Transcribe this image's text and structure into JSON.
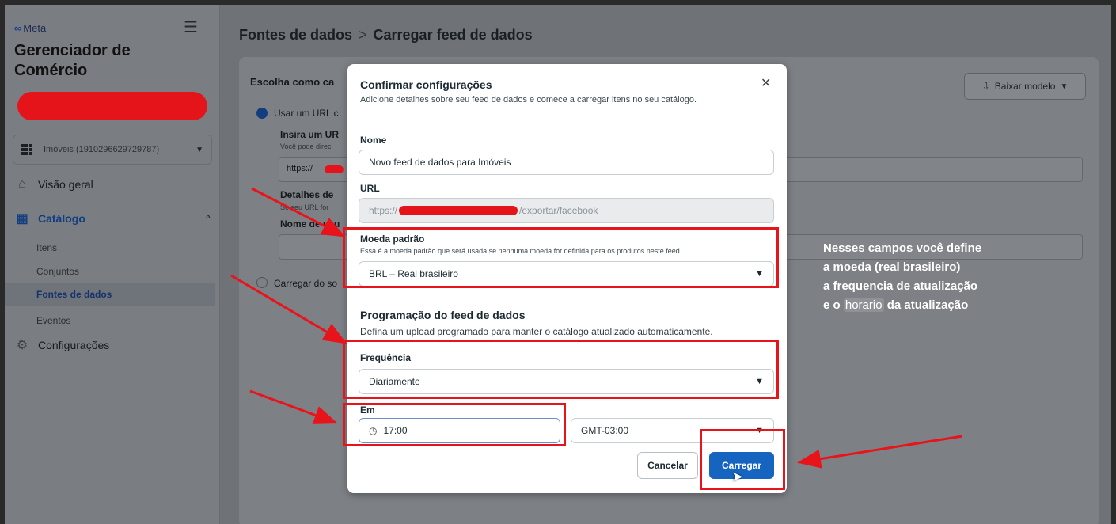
{
  "sidebar": {
    "logo": "Meta",
    "app_title": "Gerenciador de Comércio",
    "account": "Imóveis (1910296629729787)",
    "nav": {
      "overview": "Visão geral",
      "catalog": "Catálogo",
      "items": "Itens",
      "sets": "Conjuntos",
      "data_sources": "Fontes de dados",
      "events": "Eventos",
      "settings": "Configurações"
    }
  },
  "breadcrumb": {
    "root": "Fontes de dados",
    "separator": ">",
    "current": "Carregar feed de dados"
  },
  "background": {
    "choose_heading": "Escolha como ca",
    "use_url": "Usar um URL c",
    "insert_url": "Insira um UR",
    "insert_url_help": "Você pode direc",
    "url_value": "https://",
    "details": "Detalhes de",
    "details_help": "Se seu URL for",
    "username": "Nome de usu",
    "upload_from": "Carregar do so",
    "download_template": "Baixar modelo"
  },
  "modal": {
    "title": "Confirmar configurações",
    "description": "Adicione detalhes sobre seu feed de dados e comece a carregar itens no seu catálogo.",
    "name_label": "Nome",
    "name_value": "Novo feed de dados para Imóveis",
    "url_label": "URL",
    "url_prefix": "https://",
    "url_suffix": "/exportar/facebook",
    "currency_label": "Moeda padrão",
    "currency_help": "Essa é a moeda padrão que será usada se nenhuma moeda for definida para os produtos neste feed.",
    "currency_value": "BRL – Real brasileiro",
    "schedule_title": "Programação do feed de dados",
    "schedule_desc": "Defina um upload programado para manter o catálogo atualizado automaticamente.",
    "frequency_label": "Frequência",
    "frequency_value": "Diariamente",
    "at_label": "Em",
    "time_value": "17:00",
    "timezone_value": "GMT-03:00",
    "cancel": "Cancelar",
    "upload": "Carregar"
  },
  "annotation": {
    "line1": "Nesses campos você define",
    "line2": "a moeda (real brasileiro)",
    "line3": "a frequencia de atualização",
    "line4_a": "e o",
    "line4_mark": "horario",
    "line4_b": "da atualização"
  },
  "icons": {
    "close": "close-icon",
    "clock": "clock-icon",
    "download": "download-icon",
    "home": "home-icon",
    "catalog": "catalog-grid-icon",
    "settings": "gear-icon"
  },
  "colors": {
    "primary": "#1564c0",
    "annotation": "#e8141b"
  }
}
